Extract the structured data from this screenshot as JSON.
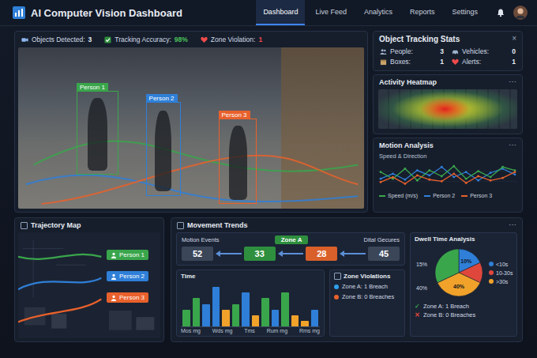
{
  "app": {
    "title": "AI Computer Vision Dashboard"
  },
  "nav": {
    "tabs": [
      {
        "label": "Dashboard",
        "selected": true
      },
      {
        "label": "Live Feed",
        "selected": false
      },
      {
        "label": "Analytics",
        "selected": false
      },
      {
        "label": "Reports",
        "selected": false
      },
      {
        "label": "Settings",
        "selected": false
      }
    ]
  },
  "live_view": {
    "stats": [
      {
        "label": "Objects Detected:",
        "value": "3",
        "color": "#e6ebf2"
      },
      {
        "label": "Tracking Accuracy:",
        "value": "98%",
        "color": "#4cc35a"
      },
      {
        "label": "Zone Violation:",
        "value": "1",
        "color": "#ef4a4a"
      }
    ],
    "detections": [
      {
        "label": "Person 1",
        "color": "#3aa64c"
      },
      {
        "label": "Person 2",
        "color": "#2f7fd8"
      },
      {
        "label": "Person 3",
        "color": "#e8612c"
      }
    ]
  },
  "tracking_stats": {
    "title": "Object Tracking Stats",
    "close": "×",
    "items": [
      {
        "label": "People:",
        "value": "3"
      },
      {
        "label": "Vehicles:",
        "value": "0"
      },
      {
        "label": "Boxes:",
        "value": "1"
      },
      {
        "label": "Alerts:",
        "value": "1"
      }
    ]
  },
  "heatmap": {
    "title": "Activity Heatmap",
    "menu": "⋯"
  },
  "motion_analysis": {
    "title": "Motion Analysis",
    "menu": "⋯",
    "subtitle": "Speed & Direction",
    "max": 3,
    "legend": [
      {
        "label": "Speed (m/s)",
        "color": "#3aa64c"
      },
      {
        "label": "Person 2",
        "color": "#2f7fd8"
      },
      {
        "label": "Person 3",
        "color": "#e8612c"
      }
    ],
    "series": [
      {
        "color": "#2f7fd8",
        "values": [
          1.2,
          1.8,
          1.1,
          2.2,
          1.6,
          2.6,
          1.4,
          2.0,
          1.0,
          1.9,
          2.4,
          1.7
        ]
      },
      {
        "color": "#3aa64c",
        "values": [
          2.0,
          1.2,
          2.4,
          1.0,
          2.2,
          1.5,
          2.7,
          1.2,
          2.1,
          1.4,
          2.6,
          2.2
        ]
      },
      {
        "color": "#e8612c",
        "values": [
          0.8,
          1.4,
          0.6,
          1.6,
          1.1,
          0.9,
          1.8,
          0.7,
          1.5,
          1.0,
          1.3,
          2.0
        ]
      }
    ]
  },
  "trajectory_map": {
    "title": "Trajectory Map",
    "tracks": [
      {
        "label": "Person 1",
        "color": "#3aa64c"
      },
      {
        "label": "Person 2",
        "color": "#2f7fd8"
      },
      {
        "label": "Person 3",
        "color": "#e8612c"
      }
    ]
  },
  "movement_trends": {
    "title": "Movement Trends",
    "menu": "⋯",
    "flow": {
      "left_label": "Motion Events",
      "center_label": "Zone A",
      "right_label": "Dital Gecures",
      "nodes": [
        {
          "value": "52",
          "color": "#3b4659"
        },
        {
          "value": "33",
          "color": "#2e8f3e"
        },
        {
          "value": "28",
          "color": "#d9602a"
        },
        {
          "value": "45",
          "color": "#3b4659"
        }
      ]
    },
    "time_chart": {
      "title": "Time",
      "max": 8,
      "bars": [
        {
          "value": 3,
          "color": "#3aa64c"
        },
        {
          "value": 5,
          "color": "#3aa64c"
        },
        {
          "value": 4,
          "color": "#2f7fd8"
        },
        {
          "value": 7,
          "color": "#2f7fd8"
        },
        {
          "value": 3,
          "color": "#f0a22a"
        },
        {
          "value": 4,
          "color": "#3aa64c"
        },
        {
          "value": 6,
          "color": "#2f7fd8"
        },
        {
          "value": 2,
          "color": "#f0a22a"
        },
        {
          "value": 5,
          "color": "#3aa64c"
        },
        {
          "value": 3,
          "color": "#2f7fd8"
        },
        {
          "value": 6,
          "color": "#3aa64c"
        },
        {
          "value": 2,
          "color": "#f0a22a"
        },
        {
          "value": 1,
          "color": "#f0a22a"
        },
        {
          "value": 3,
          "color": "#2f7fd8"
        }
      ],
      "x_labels": [
        "Mos mg",
        "Wds mg",
        "Tms",
        "Rum mg",
        "Rms mg"
      ]
    },
    "zone_violations": {
      "title": "Zone Violations",
      "items": [
        {
          "text": "Zone A: 1 Breach",
          "color": "#2f9fe8"
        },
        {
          "text": "Zone B: 0 Breaches",
          "color": "#e8612c"
        }
      ]
    },
    "dwell_time": {
      "title": "Dwell Time Analysis",
      "slices": [
        {
          "value": 18,
          "color": "#2f7fd8",
          "label": "10%"
        },
        {
          "value": 14,
          "color": "#e0473c"
        },
        {
          "value": 36,
          "color": "#f0a22a",
          "label": "40%"
        },
        {
          "value": 32,
          "color": "#3aa64c"
        }
      ],
      "outer_labels": [
        "15%",
        "40%"
      ],
      "legend": [
        {
          "label": "<10s",
          "color": "#2f7fd8"
        },
        {
          "label": "10-30s",
          "color": "#e0473c"
        },
        {
          "label": ">30s",
          "color": "#f0a22a"
        }
      ],
      "results": [
        {
          "mark": "✓",
          "text": "Zone A: 1 Breach",
          "color": "#3aa64c"
        },
        {
          "mark": "✕",
          "text": "Zone B: 0 Breaches",
          "color": "#e0473c"
        }
      ]
    }
  }
}
